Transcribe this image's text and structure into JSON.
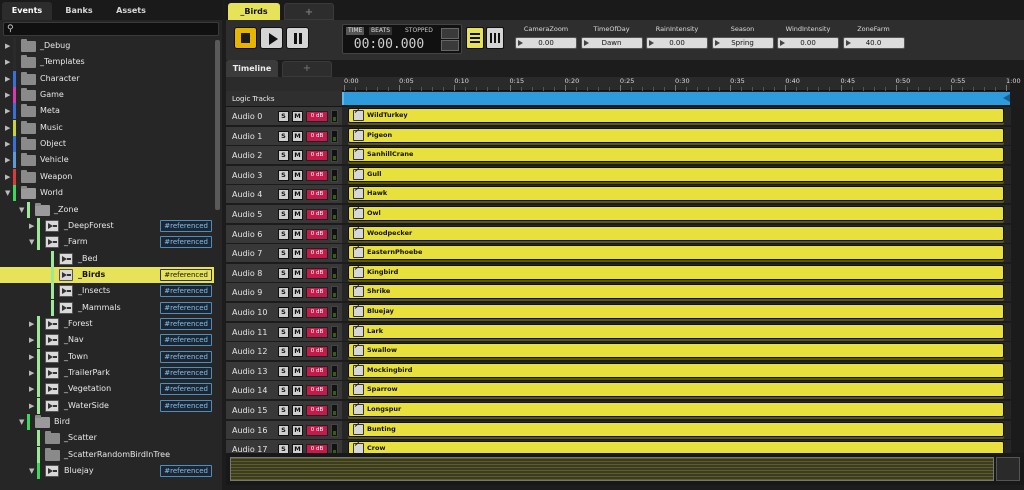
{
  "left_tabs": [
    "Events",
    "Banks",
    "Assets"
  ],
  "search": {
    "placeholder": ""
  },
  "tree": [
    {
      "label": "_Debug",
      "type": "folder",
      "depth": 0,
      "arrow": "▶",
      "color": "#2a2a2a"
    },
    {
      "label": "_Templates",
      "type": "folder",
      "depth": 0,
      "arrow": "▶",
      "color": "#2a2a2a"
    },
    {
      "label": "Character",
      "type": "folder",
      "depth": 0,
      "arrow": "▶",
      "color": "#3b6fd8"
    },
    {
      "label": "Game",
      "type": "folder",
      "depth": 0,
      "arrow": "▶",
      "color": "#d43bb0"
    },
    {
      "label": "Meta",
      "type": "folder",
      "depth": 0,
      "arrow": "▶",
      "color": "#3b6fd8"
    },
    {
      "label": "Music",
      "type": "folder",
      "depth": 0,
      "arrow": "▶",
      "color": "#c9d23b"
    },
    {
      "label": "Object",
      "type": "folder",
      "depth": 0,
      "arrow": "▶",
      "color": "#3b6fd8"
    },
    {
      "label": "Vehicle",
      "type": "folder",
      "depth": 0,
      "arrow": "▶",
      "color": "#5c9ad8"
    },
    {
      "label": "Weapon",
      "type": "folder",
      "depth": 0,
      "arrow": "▶",
      "color": "#d83b3b"
    },
    {
      "label": "World",
      "type": "folder",
      "depth": 0,
      "arrow": "▼",
      "color": "#3bd85a",
      "open": true
    },
    {
      "label": "_Zone",
      "type": "folder",
      "depth": 1,
      "arrow": "▼",
      "color": "#9ee89a",
      "open": true
    },
    {
      "label": "_DeepForest",
      "type": "event",
      "depth": 2,
      "arrow": "▶",
      "color": "#9ee89a",
      "ref": "#referenced"
    },
    {
      "label": "_Farm",
      "type": "event",
      "depth": 2,
      "arrow": "▼",
      "color": "#9ee89a",
      "ref": "#referenced"
    },
    {
      "label": "_Bed",
      "type": "event",
      "depth": 3,
      "arrow": "",
      "color": "#9ee89a"
    },
    {
      "label": "_Birds",
      "type": "event",
      "depth": 3,
      "arrow": "",
      "color": "#9ee89a",
      "ref": "#referenced",
      "selected": true
    },
    {
      "label": "_Insects",
      "type": "event",
      "depth": 3,
      "arrow": "",
      "color": "#9ee89a",
      "ref": "#referenced"
    },
    {
      "label": "_Mammals",
      "type": "event",
      "depth": 3,
      "arrow": "",
      "color": "#9ee89a",
      "ref": "#referenced"
    },
    {
      "label": "_Forest",
      "type": "event",
      "depth": 2,
      "arrow": "▶",
      "color": "#9ee89a",
      "ref": "#referenced"
    },
    {
      "label": "_Nav",
      "type": "event",
      "depth": 2,
      "arrow": "▶",
      "color": "#9ee89a",
      "ref": "#referenced"
    },
    {
      "label": "_Town",
      "type": "event",
      "depth": 2,
      "arrow": "▶",
      "color": "#9ee89a",
      "ref": "#referenced"
    },
    {
      "label": "_TrailerPark",
      "type": "event",
      "depth": 2,
      "arrow": "▶",
      "color": "#9ee89a",
      "ref": "#referenced"
    },
    {
      "label": "_Vegetation",
      "type": "event",
      "depth": 2,
      "arrow": "▶",
      "color": "#9ee89a",
      "ref": "#referenced"
    },
    {
      "label": "_WaterSide",
      "type": "event",
      "depth": 2,
      "arrow": "▶",
      "color": "#9ee89a",
      "ref": "#referenced"
    },
    {
      "label": "Bird",
      "type": "folder",
      "depth": 1,
      "arrow": "▼",
      "color": "#3bd85a",
      "open": true
    },
    {
      "label": "_Scatter",
      "type": "folder",
      "depth": 2,
      "arrow": "",
      "color": "#9ee89a"
    },
    {
      "label": "_ScatterRandomBirdInTree",
      "type": "folder",
      "depth": 2,
      "arrow": "",
      "color": "#9ee89a"
    },
    {
      "label": "Bluejay",
      "type": "event",
      "depth": 2,
      "arrow": "▼",
      "color": "#3bd85a",
      "ref": "#referenced"
    }
  ],
  "editor_tabs": {
    "active": "_Birds",
    "add": "+"
  },
  "transport": {
    "time_label": "TIME",
    "beats_label": "BEATS",
    "state": "STOPPED",
    "timecode": "00:00.000"
  },
  "parameters": [
    {
      "name": "CameraZoom",
      "value": "0.00"
    },
    {
      "name": "TimeOfDay",
      "value": "Dawn"
    },
    {
      "name": "RainIntensity",
      "value": "0.00"
    },
    {
      "name": "Season",
      "value": "Spring"
    },
    {
      "name": "WindIntensity",
      "value": "0.00"
    },
    {
      "name": "ZoneFarm",
      "value": "40.0"
    }
  ],
  "timeline": {
    "tab": "Timeline",
    "add": "+",
    "ruler": [
      "0:00",
      "0:05",
      "0:10",
      "0:15",
      "0:20",
      "0:25",
      "0:30",
      "0:35",
      "0:40",
      "0:45",
      "0:50",
      "0:55",
      "1:00"
    ],
    "logic_tracks_label": "Logic Tracks"
  },
  "tracks": [
    {
      "name": "Audio 0",
      "clip": "WildTurkey"
    },
    {
      "name": "Audio 1",
      "clip": "Pigeon"
    },
    {
      "name": "Audio 2",
      "clip": "SanhillCrane"
    },
    {
      "name": "Audio 3",
      "clip": "Gull"
    },
    {
      "name": "Audio 4",
      "clip": "Hawk"
    },
    {
      "name": "Audio 5",
      "clip": "Owl"
    },
    {
      "name": "Audio 6",
      "clip": "Woodpecker"
    },
    {
      "name": "Audio 7",
      "clip": "EasternPhoebe"
    },
    {
      "name": "Audio 8",
      "clip": "Kingbird"
    },
    {
      "name": "Audio 9",
      "clip": "Shrike"
    },
    {
      "name": "Audio 10",
      "clip": "Bluejay"
    },
    {
      "name": "Audio 11",
      "clip": "Lark"
    },
    {
      "name": "Audio 12",
      "clip": "Swallow"
    },
    {
      "name": "Audio 13",
      "clip": "Mockingbird"
    },
    {
      "name": "Audio 14",
      "clip": "Sparrow"
    },
    {
      "name": "Audio 15",
      "clip": "Longspur"
    },
    {
      "name": "Audio 16",
      "clip": "Bunting"
    },
    {
      "name": "Audio 17",
      "clip": "Crow"
    }
  ],
  "track_controls": {
    "solo": "S",
    "mute": "M",
    "volume": "0 dB"
  },
  "colors": {
    "selection": "#e6e35a",
    "clip": "#e8e03c",
    "logic": "#2d9bdc",
    "stop_button": "#e7b400",
    "volume": "#c41b4a"
  }
}
